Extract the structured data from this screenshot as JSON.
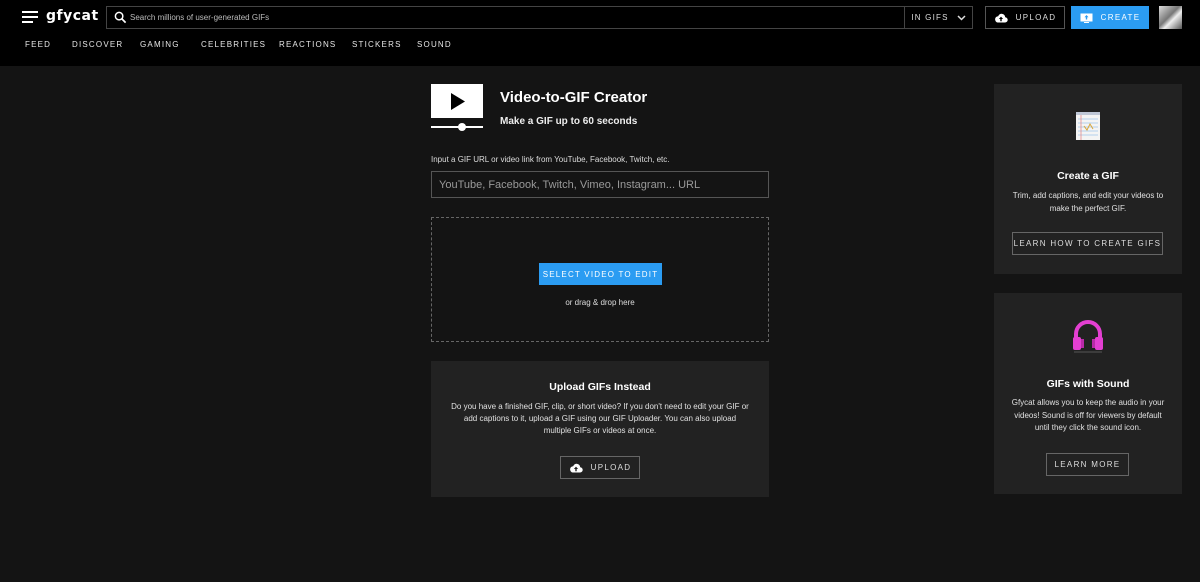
{
  "header": {
    "logo": "gfycat",
    "search_placeholder": "Search millions of user-generated GIFs",
    "search_scope": "IN GIFS",
    "upload_label": "UPLOAD",
    "create_label": "CREATE"
  },
  "nav": {
    "items": [
      "FEED",
      "DISCOVER",
      "GAMING",
      "CELEBRITIES",
      "REACTIONS",
      "STICKERS",
      "SOUND"
    ]
  },
  "creator": {
    "title": "Video-to-GIF Creator",
    "subtitle": "Make a GIF up to 60 seconds",
    "url_label": "Input a GIF URL or video link from YouTube, Facebook, Twitch, etc.",
    "url_placeholder": "YouTube, Facebook, Twitch, Vimeo, Instagram... URL",
    "select_button": "SELECT VIDEO TO EDIT",
    "drag_drop_text": "or drag & drop here"
  },
  "upload_card": {
    "title": "Upload GIFs Instead",
    "body": "Do you have a finished GIF, clip, or short video? If you don't need to edit your GIF or add captions to it, upload a GIF using our GIF Uploader. You can also upload multiple GIFs or videos at once.",
    "button": "UPLOAD"
  },
  "side_cards": {
    "create": {
      "icon": "notepad-icon",
      "title": "Create a GIF",
      "body": "Trim, add captions, and edit your videos to make the perfect GIF.",
      "button": "LEARN HOW TO CREATE GIFS"
    },
    "sound": {
      "icon": "headphones-icon",
      "title": "GIFs with Sound",
      "body": "Gfycat allows you to keep the audio in your videos! Sound is off for viewers by default until they click the sound icon.",
      "button": "LEARN MORE"
    }
  },
  "colors": {
    "accent": "#2b9cf2",
    "background": "#141414",
    "header": "#000000",
    "card": "#222222",
    "headphones": "#e43fd2"
  }
}
